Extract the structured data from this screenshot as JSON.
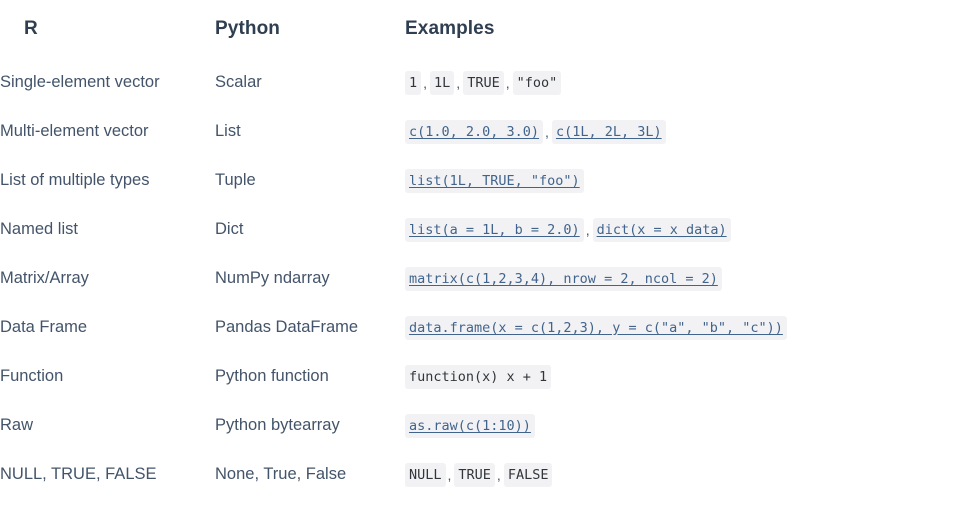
{
  "table": {
    "headers": {
      "r": "R",
      "python": "Python",
      "examples": "Examples"
    },
    "rows": [
      {
        "r": "Single-element vector",
        "python": "Scalar",
        "examples": [
          {
            "text": "1",
            "link": false
          },
          {
            "text": "1L",
            "link": false
          },
          {
            "text": "TRUE",
            "link": false
          },
          {
            "text": "\"foo\"",
            "link": false
          }
        ]
      },
      {
        "r": "Multi-element vector",
        "python": "List",
        "examples": [
          {
            "text": "c(1.0, 2.0, 3.0)",
            "link": true
          },
          {
            "text": "c(1L, 2L, 3L)",
            "link": true
          }
        ]
      },
      {
        "r": "List of multiple types",
        "python": "Tuple",
        "examples": [
          {
            "text": "list(1L, TRUE, \"foo\")",
            "link": true
          }
        ]
      },
      {
        "r": "Named list",
        "python": "Dict",
        "examples": [
          {
            "text": "list(a = 1L, b = 2.0)",
            "link": true
          },
          {
            "text": "dict(x = x_data)",
            "link": true
          }
        ]
      },
      {
        "r": "Matrix/Array",
        "python": "NumPy ndarray",
        "examples": [
          {
            "text": "matrix(c(1,2,3,4), nrow = 2, ncol = 2)",
            "link": true
          }
        ]
      },
      {
        "r": "Data Frame",
        "python": "Pandas DataFrame",
        "examples": [
          {
            "text": "data.frame(x = c(1,2,3), y = c(\"a\", \"b\", \"c\"))",
            "link": true
          }
        ]
      },
      {
        "r": "Function",
        "python": "Python function",
        "examples": [
          {
            "text": "function(x) x + 1",
            "link": false
          }
        ]
      },
      {
        "r": "Raw",
        "python": "Python bytearray",
        "examples": [
          {
            "text": "as.raw(c(1:10))",
            "link": true
          }
        ]
      },
      {
        "r": "NULL, TRUE, FALSE",
        "python": "None, True, False",
        "examples": [
          {
            "text": "NULL",
            "link": false
          },
          {
            "text": "TRUE",
            "link": false
          },
          {
            "text": "FALSE",
            "link": false
          }
        ]
      }
    ],
    "separator": ","
  }
}
